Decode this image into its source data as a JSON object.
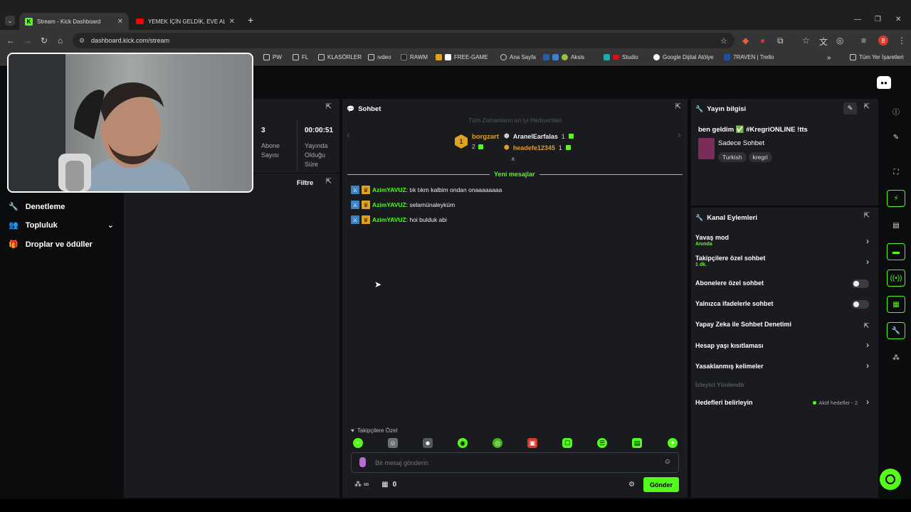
{
  "browser": {
    "tabs": [
      {
        "title": "Stream - Kick Dashboard",
        "active": true
      },
      {
        "title": "YEMEK İÇİN GELDİK, EVE ALMA",
        "active": false
      }
    ],
    "new_tab": "+",
    "url": "dashboard.kick.com/stream",
    "profile_initial": "B",
    "bookmarks": [
      "PW",
      "FL",
      "KLASÖRLER",
      "ıvdeo",
      "RAWM",
      "FREE-GAME",
      "Ana Sayfa",
      "Aksis",
      "Studio",
      "Google Dijital Atölye",
      "7RAVEN | Trello"
    ],
    "all_bookmarks": "Tüm Yer İşaretleri",
    "overflow": "»"
  },
  "colors": {
    "accent": "#53fc18",
    "panel": "#191b1f",
    "page": "#0b0c0d",
    "gold": "#e0a321"
  },
  "sidebar": {
    "items": [
      {
        "label": "Denetleme",
        "icon": "wrench-icon"
      },
      {
        "label": "Topluluk",
        "icon": "users-icon"
      },
      {
        "label": "Droplar ve ödüller",
        "icon": "gift-icon"
      }
    ]
  },
  "stats": {
    "subs_value": "3",
    "subs_label": "Abone Sayısı",
    "uptime_value": "00:00:51",
    "uptime_label": "Yayında Olduğu Süre"
  },
  "activity": {
    "filter_label": "Filtre"
  },
  "chat": {
    "title": "Sohbet",
    "gifters_title": "Tüm Zamanların en iyi Hediyecileri",
    "top_gifter": {
      "rank": "1",
      "name": "borgzart",
      "count": "2"
    },
    "gifters": [
      {
        "name": "AranelEarfalas",
        "count": "1"
      },
      {
        "name": "headefe12345",
        "count": "1"
      }
    ],
    "new_messages_label": "Yeni mesajlar",
    "messages": [
      {
        "user": "AzimYAVUZ",
        "text": ": tık tıkm kalbim ondan onaaaaaaaa"
      },
      {
        "user": "AzimYAVUZ",
        "text": ": selamünaleyküm"
      },
      {
        "user": "AzimYAVUZ",
        "text": ": hoi bulduk abi"
      }
    ],
    "followers_only_label": "Takipçilere Özel",
    "input_placeholder": "Bir mesaj gönderin",
    "infinity": "∞",
    "points": "0",
    "send_label": "Gönder"
  },
  "stream_info": {
    "title": "Yayın bilgisi",
    "stream_title": "ben geldim ✅ #KregriONLINE !tts",
    "category": "Sadece Sohbet",
    "tags": [
      "Turkish",
      "kregri"
    ]
  },
  "channel_actions": {
    "title": "Kanal Eylemleri",
    "slow_mode": {
      "label": "Yavaş mod",
      "value": "Anında"
    },
    "followers_chat": {
      "label": "Takipçilere özel sohbet",
      "value": "1 dk."
    },
    "subs_chat": "Abonelere özel sohbet",
    "emote_chat": "Yalnızca ifadelerle sohbet",
    "ai_moderation": "Yapay Zeka ile Sohbet Denetimi",
    "age_restriction": "Hesap yaşı kısıtlaması",
    "banned_words": "Yasaklanmış kelimeler",
    "viewer_redirect": "İzleyici Yönlendir",
    "goals": {
      "label": "Hedefleri belirleyin",
      "status": "Aktif hedefler - 2"
    }
  }
}
